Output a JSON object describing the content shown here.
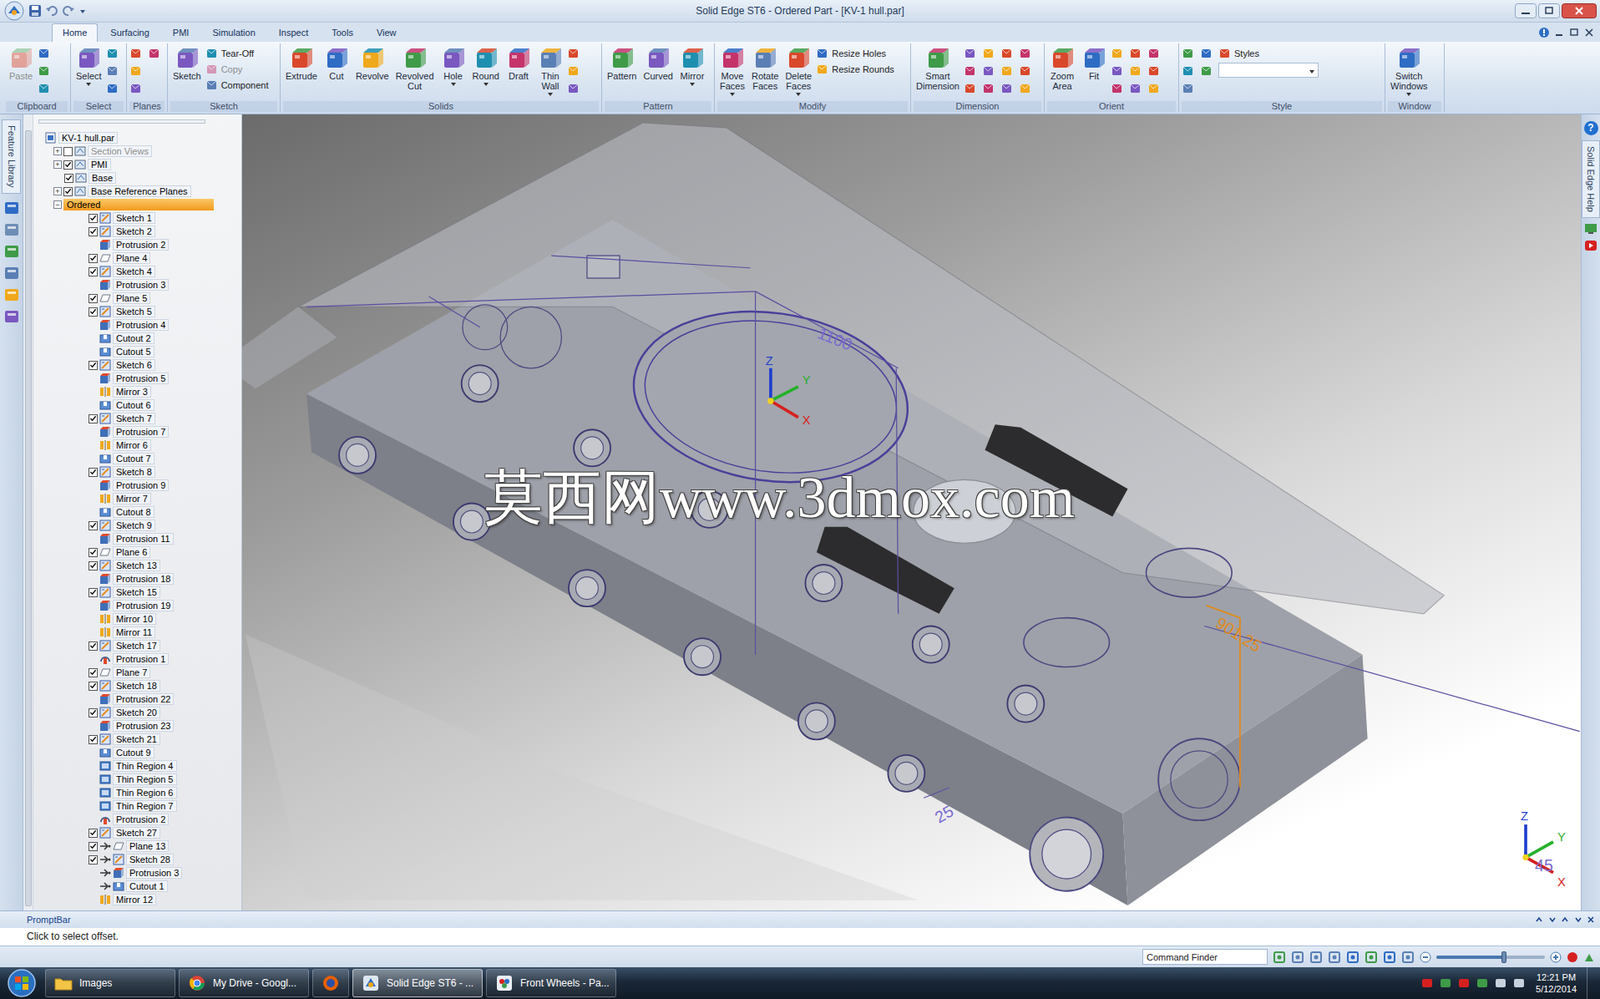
{
  "window": {
    "title": "Solid Edge ST6 - Ordered Part - [KV-1 hull.par]"
  },
  "ribbon": {
    "tabs": [
      {
        "label": "Home",
        "selected": true
      },
      {
        "label": "Surfacing",
        "selected": false
      },
      {
        "label": "PMI",
        "selected": false
      },
      {
        "label": "Simulation",
        "selected": false
      },
      {
        "label": "Inspect",
        "selected": false
      },
      {
        "label": "Tools",
        "selected": false
      },
      {
        "label": "View",
        "selected": false
      }
    ],
    "groups": [
      {
        "name": "Clipboard",
        "buttons": [
          {
            "label": "Paste",
            "kind": "large",
            "disabled": true,
            "dropdown": false
          }
        ]
      },
      {
        "name": "Select",
        "buttons": [
          {
            "label": "Select",
            "kind": "large",
            "disabled": false,
            "dropdown": true
          }
        ]
      },
      {
        "name": "Planes",
        "buttons": []
      },
      {
        "name": "Sketch",
        "buttons": [
          {
            "label": "Sketch",
            "kind": "large",
            "disabled": false,
            "dropdown": false
          },
          {
            "label": "Tear-Off",
            "kind": "small",
            "disabled": false,
            "dropdown": false
          },
          {
            "label": "Copy",
            "kind": "small",
            "disabled": true,
            "dropdown": false
          },
          {
            "label": "Component",
            "kind": "small",
            "disabled": false,
            "dropdown": false
          }
        ]
      },
      {
        "name": "Solids",
        "buttons": [
          {
            "label": "Extrude",
            "kind": "large",
            "disabled": false,
            "dropdown": false
          },
          {
            "label": "Cut",
            "kind": "large",
            "disabled": false,
            "dropdown": false
          },
          {
            "label": "Revolve",
            "kind": "large",
            "disabled": false,
            "dropdown": false
          },
          {
            "label": "Revolved Cut",
            "kind": "large",
            "disabled": false,
            "dropdown": false
          },
          {
            "label": "Hole",
            "kind": "large",
            "disabled": false,
            "dropdown": true
          },
          {
            "label": "Round",
            "kind": "large",
            "disabled": false,
            "dropdown": true
          },
          {
            "label": "Draft",
            "kind": "large",
            "disabled": false,
            "dropdown": false
          },
          {
            "label": "Thin Wall",
            "kind": "large",
            "disabled": false,
            "dropdown": true
          }
        ]
      },
      {
        "name": "Pattern",
        "buttons": [
          {
            "label": "Pattern",
            "kind": "large",
            "disabled": false,
            "dropdown": false
          },
          {
            "label": "Curved",
            "kind": "large",
            "disabled": false,
            "dropdown": false
          },
          {
            "label": "Mirror",
            "kind": "large",
            "disabled": false,
            "dropdown": true
          }
        ]
      },
      {
        "name": "Modify",
        "buttons": [
          {
            "label": "Move Faces",
            "kind": "large",
            "disabled": false,
            "dropdown": true
          },
          {
            "label": "Rotate Faces",
            "kind": "large",
            "disabled": false,
            "dropdown": false
          },
          {
            "label": "Delete Faces",
            "kind": "large",
            "disabled": false,
            "dropdown": true
          },
          {
            "label": "Resize Holes",
            "kind": "small",
            "disabled": false,
            "dropdown": false
          },
          {
            "label": "Resize Rounds",
            "kind": "small",
            "disabled": false,
            "dropdown": false
          }
        ]
      },
      {
        "name": "Dimension",
        "buttons": [
          {
            "label": "Smart Dimension",
            "kind": "large",
            "disabled": false,
            "dropdown": false
          }
        ]
      },
      {
        "name": "Orient",
        "buttons": [
          {
            "label": "Zoom Area",
            "kind": "large",
            "disabled": false,
            "dropdown": false
          },
          {
            "label": "Fit",
            "kind": "large",
            "disabled": false,
            "dropdown": false
          }
        ]
      },
      {
        "name": "Style",
        "buttons": [
          {
            "label": "Styles",
            "kind": "combo",
            "disabled": false,
            "dropdown": false
          }
        ]
      },
      {
        "name": "Window",
        "buttons": [
          {
            "label": "Switch Windows",
            "kind": "large",
            "disabled": false,
            "dropdown": true
          }
        ]
      }
    ]
  },
  "left_strip": {
    "tab": "Feature Library"
  },
  "tree": {
    "items": [
      {
        "label": "KV-1 hull.par",
        "kind": "part",
        "selected": false
      },
      {
        "label": "Section Views",
        "kind": "folder",
        "expander": "+",
        "checked": false,
        "disabled": true,
        "selected": false
      },
      {
        "label": "PMI",
        "kind": "folder",
        "expander": "+",
        "checked": true,
        "selected": false
      },
      {
        "label": "Base",
        "kind": "folder",
        "checked": true,
        "selected": false
      },
      {
        "label": "Base Reference Planes",
        "kind": "folder",
        "expander": "+",
        "checked": true,
        "selected": false
      },
      {
        "label": "Ordered",
        "kind": "group",
        "expander": "−",
        "selected": true
      },
      {
        "label": "Sketch 1",
        "kind": "sketch",
        "checked": true,
        "selected": false
      },
      {
        "label": "Sketch 2",
        "kind": "sketch",
        "checked": true,
        "selected": false
      },
      {
        "label": "Protrusion 2",
        "kind": "protrusion",
        "selected": false
      },
      {
        "label": "Plane 4",
        "kind": "plane",
        "checked": true,
        "selected": false
      },
      {
        "label": "Sketch 4",
        "kind": "sketch",
        "checked": true,
        "selected": false
      },
      {
        "label": "Protrusion 3",
        "kind": "protrusion",
        "selected": false
      },
      {
        "label": "Plane 5",
        "kind": "plane",
        "checked": true,
        "selected": false
      },
      {
        "label": "Sketch 5",
        "kind": "sketch",
        "checked": true,
        "selected": false
      },
      {
        "label": "Protrusion 4",
        "kind": "protrusion",
        "selected": false
      },
      {
        "label": "Cutout 2",
        "kind": "cutout",
        "selected": false
      },
      {
        "label": "Cutout 5",
        "kind": "cutout",
        "selected": false
      },
      {
        "label": "Sketch 6",
        "kind": "sketch",
        "checked": true,
        "selected": false
      },
      {
        "label": "Protrusion 5",
        "kind": "protrusion",
        "selected": false
      },
      {
        "label": "Mirror 3",
        "kind": "mirror",
        "selected": false
      },
      {
        "label": "Cutout 6",
        "kind": "cutout",
        "selected": false
      },
      {
        "label": "Sketch 7",
        "kind": "sketch",
        "checked": true,
        "selected": false
      },
      {
        "label": "Protrusion 7",
        "kind": "protrusion",
        "selected": false
      },
      {
        "label": "Mirror 6",
        "kind": "mirror",
        "selected": false
      },
      {
        "label": "Cutout 7",
        "kind": "cutout",
        "selected": false
      },
      {
        "label": "Sketch 8",
        "kind": "sketch",
        "checked": true,
        "selected": false
      },
      {
        "label": "Protrusion 9",
        "kind": "protrusion",
        "selected": false
      },
      {
        "label": "Mirror 7",
        "kind": "mirror",
        "selected": false
      },
      {
        "label": "Cutout 8",
        "kind": "cutout",
        "selected": false
      },
      {
        "label": "Sketch 9",
        "kind": "sketch",
        "checked": true,
        "selected": false
      },
      {
        "label": "Protrusion 11",
        "kind": "protrusion",
        "selected": false
      },
      {
        "label": "Plane 6",
        "kind": "plane",
        "checked": true,
        "selected": false
      },
      {
        "label": "Sketch 13",
        "kind": "sketch",
        "checked": true,
        "selected": false
      },
      {
        "label": "Protrusion 18",
        "kind": "protrusion",
        "selected": false
      },
      {
        "label": "Sketch 15",
        "kind": "sketch",
        "checked": true,
        "selected": false
      },
      {
        "label": "Protrusion 19",
        "kind": "protrusion",
        "selected": false
      },
      {
        "label": "Mirror 10",
        "kind": "mirror",
        "selected": false
      },
      {
        "label": "Mirror 11",
        "kind": "mirror",
        "selected": false
      },
      {
        "label": "Sketch 17",
        "kind": "sketch",
        "checked": true,
        "selected": false
      },
      {
        "label": "Protrusion 1",
        "kind": "revolve",
        "selected": false
      },
      {
        "label": "Plane 7",
        "kind": "plane",
        "checked": true,
        "selected": false
      },
      {
        "label": "Sketch 18",
        "kind": "sketch",
        "checked": true,
        "selected": false
      },
      {
        "label": "Protrusion 22",
        "kind": "protrusion",
        "selected": false
      },
      {
        "label": "Sketch 20",
        "kind": "sketch",
        "checked": true,
        "selected": false
      },
      {
        "label": "Protrusion 23",
        "kind": "protrusion",
        "selected": false
      },
      {
        "label": "Sketch 21",
        "kind": "sketch",
        "checked": true,
        "selected": false
      },
      {
        "label": "Cutout 9",
        "kind": "cutout",
        "selected": false
      },
      {
        "label": "Thin Region 4",
        "kind": "thin-region",
        "selected": false
      },
      {
        "label": "Thin Region 5",
        "kind": "thin-region",
        "selected": false
      },
      {
        "label": "Thin Region 6",
        "kind": "thin-region",
        "selected": false
      },
      {
        "label": "Thin Region 7",
        "kind": "thin-region",
        "selected": false
      },
      {
        "label": "Protrusion 2",
        "kind": "revolve",
        "selected": false
      },
      {
        "label": "Sketch 27",
        "kind": "sketch",
        "checked": true,
        "selected": false
      },
      {
        "label": "Plane 13",
        "kind": "plane",
        "checked": true,
        "rolled": true,
        "selected": false
      },
      {
        "label": "Sketch 28",
        "kind": "sketch",
        "checked": true,
        "rolled": true,
        "selected": false
      },
      {
        "label": "Protrusion 3",
        "kind": "protrusion",
        "rolled": true,
        "selected": false
      },
      {
        "label": "Cutout 1",
        "kind": "cutout",
        "rolled": true,
        "selected": false
      },
      {
        "label": "Mirror 12",
        "kind": "mirror",
        "selected": false
      }
    ]
  },
  "viewport": {
    "watermark": "莫西网www.3dmox.com",
    "dimensions": [
      {
        "text": "1100",
        "color": "#7a6ad0"
      },
      {
        "text": "901.25",
        "color": "#e08a1e"
      },
      {
        "text": "25",
        "color": "#7a6ad0"
      },
      {
        "text": "45",
        "color": "#7a6ad0"
      }
    ],
    "triad_labels": [
      "Z",
      "Y",
      "X"
    ],
    "corner_triad_labels": [
      "Z",
      "Y",
      "X"
    ]
  },
  "right_strip": {
    "help_glyph": "?",
    "tab": "Solid Edge Help"
  },
  "prompt_bar": {
    "title": "PromptBar",
    "text": "Click to select offset."
  },
  "status_bar": {
    "command_finder": {
      "placeholder": "Command Finder"
    },
    "zoom": {
      "level": 0.62
    }
  },
  "taskbar": {
    "items": [
      {
        "label": "Images",
        "kind": "app",
        "selected": false
      },
      {
        "label": "My Drive - Googl...",
        "kind": "app",
        "selected": false
      },
      {
        "kind": "icon",
        "selected": false
      },
      {
        "label": "Solid Edge ST6 - ...",
        "kind": "app",
        "selected": true
      },
      {
        "label": "Front Wheels - Pa...",
        "kind": "app",
        "selected": false
      }
    ],
    "clock": {
      "time": "12:21 PM",
      "date": "5/12/2014"
    }
  }
}
